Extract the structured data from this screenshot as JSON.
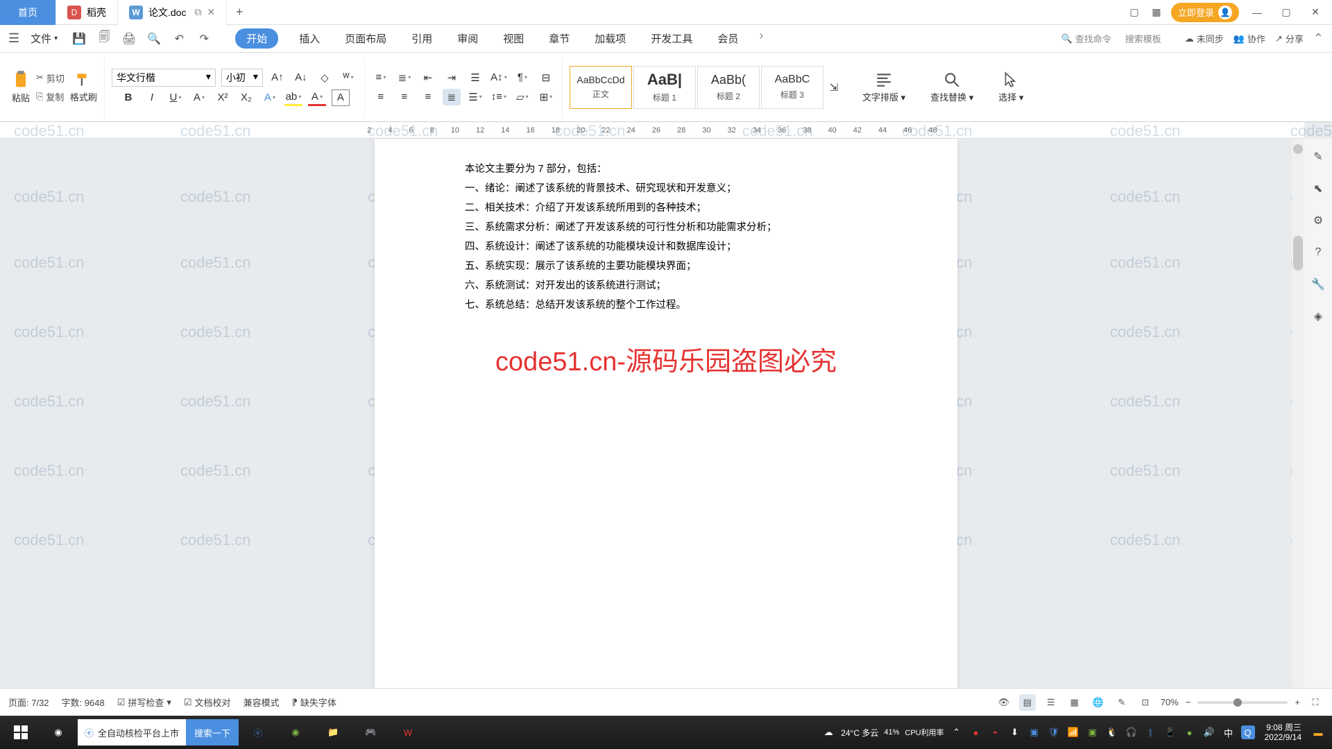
{
  "titlebar": {
    "tabs": [
      {
        "label": "首页",
        "type": "home"
      },
      {
        "label": "稻壳",
        "icon": "red"
      },
      {
        "label": "论文.doc",
        "icon": "blue",
        "active": true
      }
    ],
    "login": "立即登录"
  },
  "menubar": {
    "file": "文件",
    "tabs": [
      "开始",
      "插入",
      "页面布局",
      "引用",
      "审阅",
      "视图",
      "章节",
      "加载项",
      "开发工具",
      "会员"
    ],
    "active_tab": "开始",
    "search_cmd": "查找命令",
    "search_tpl": "搜索模板",
    "right": {
      "sync": "未同步",
      "collab": "协作",
      "share": "分享"
    }
  },
  "ribbon": {
    "clipboard": {
      "paste": "粘贴",
      "cut": "剪切",
      "copy": "复制",
      "format_painter": "格式刷"
    },
    "font": {
      "family": "华文行楷",
      "size": "小初"
    },
    "styles": [
      {
        "preview": "AaBbCcDd",
        "name": "正文",
        "sel": true
      },
      {
        "preview": "AaB|",
        "name": "标题 1",
        "big": true
      },
      {
        "preview": "AaBb(",
        "name": "标题 2"
      },
      {
        "preview": "AaBbC",
        "name": "标题 3"
      }
    ],
    "text_layout": "文字排版",
    "find_replace": "查找替换",
    "select": "选择"
  },
  "ruler_marks": [
    "2",
    "4",
    "6",
    "8",
    "10",
    "12",
    "14",
    "16",
    "18",
    "20",
    "22",
    "24",
    "26",
    "28",
    "30",
    "32",
    "34",
    "36",
    "38",
    "40",
    "42",
    "44",
    "46",
    "48"
  ],
  "document": {
    "lines": [
      "本论文主要分为 7 部分，包括：",
      "一、绪论：阐述了该系统的背景技术、研究现状和开发意义；",
      "二、相关技术：介绍了开发该系统所用到的各种技术；",
      "三、系统需求分析：阐述了开发该系统的可行性分析和功能需求分析；",
      "四、系统设计：阐述了该系统的功能模块设计和数据库设计；",
      "五、系统实现：展示了该系统的主要功能模块界面；",
      "六、系统测试：对开发出的该系统进行测试；",
      "七、系统总结：总结开发该系统的整个工作过程。"
    ],
    "watermark_big": "code51.cn-源码乐园盗图必究",
    "watermark_small": "code51.cn"
  },
  "statusbar": {
    "page": "页面: 7/32",
    "words": "字数: 9648",
    "spellcheck": "拼写检查",
    "docproof": "文档校对",
    "compat": "兼容模式",
    "missing_font": "缺失字体",
    "zoom": "70%"
  },
  "taskbar": {
    "ie_text": "全自动核检平台上市",
    "search": "搜索一下",
    "weather": "24°C 多云",
    "cpu": "CPU利用率",
    "cpu_pct": "41%",
    "ime": "中",
    "time": "9:08",
    "day": "周三",
    "date": "2022/9/14"
  }
}
